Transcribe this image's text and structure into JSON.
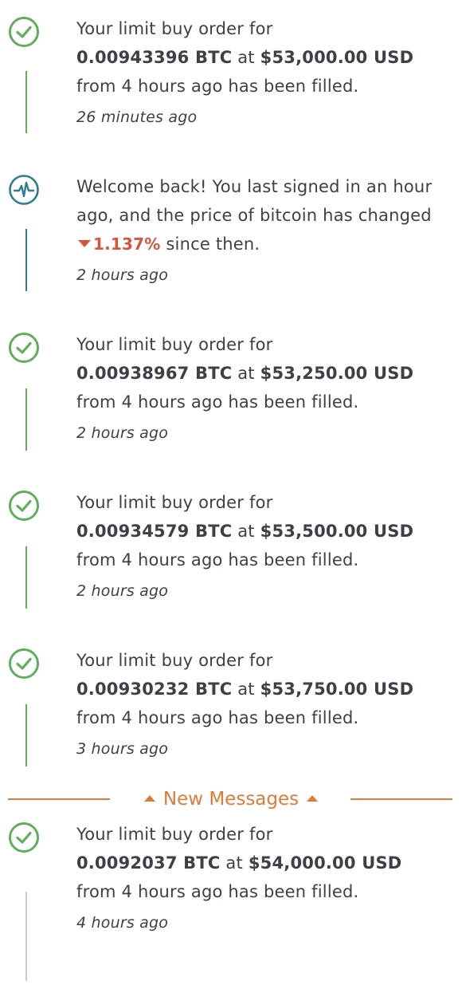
{
  "colors": {
    "success": "#5fae5a",
    "info": "#2f7e8e",
    "accent": "#e07a37",
    "negative": "#d9533d",
    "text": "#3c4148",
    "muted_line": "#cccccc"
  },
  "divider": {
    "label": "New Messages",
    "icon": "caret-up-icon"
  },
  "notifications": [
    {
      "icon": "check-circle-icon",
      "intro": "Your limit buy order for",
      "amount": "0.00943396 BTC",
      "at": "at",
      "price": "$53,000.00 USD",
      "tail": "from 4 hours ago has been filled.",
      "time": "26 minutes ago"
    },
    {
      "icon": "pulse-icon",
      "message_start": "Welcome back! You last signed in an hour ago, and the price of bitcoin has changed",
      "change": "1.137%",
      "change_direction_icon": "caret-down-icon",
      "message_end": "since then.",
      "time": "2 hours ago"
    },
    {
      "icon": "check-circle-icon",
      "intro": "Your limit buy order for",
      "amount": "0.00938967 BTC",
      "at": "at",
      "price": "$53,250.00 USD",
      "tail": "from 4 hours ago has been filled.",
      "time": "2 hours ago"
    },
    {
      "icon": "check-circle-icon",
      "intro": "Your limit buy order for",
      "amount": "0.00934579 BTC",
      "at": "at",
      "price": "$53,500.00 USD",
      "tail": "from 4 hours ago has been filled.",
      "time": "2 hours ago"
    },
    {
      "icon": "check-circle-icon",
      "intro": "Your limit buy order for",
      "amount": "0.00930232 BTC",
      "at": "at",
      "price": "$53,750.00 USD",
      "tail": "from 4 hours ago has been filled.",
      "time": "3 hours ago"
    },
    {
      "icon": "check-circle-icon",
      "intro": "Your limit buy order for",
      "amount": "0.0092037 BTC",
      "at": "at",
      "price": "$54,000.00 USD",
      "tail": "from 4 hours ago has been filled.",
      "time": "4 hours ago"
    }
  ]
}
